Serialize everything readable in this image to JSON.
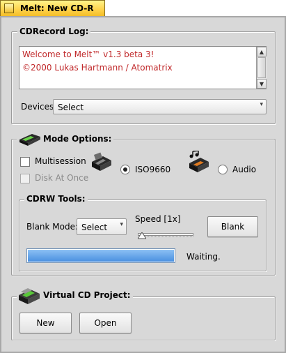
{
  "window": {
    "title": "Melt: New CD-R",
    "accent": "#ffd24a"
  },
  "log": {
    "label": "CDRecord Log:",
    "lines": [
      "Welcome to Melt™ v1.3 beta 3!",
      "©2000 Lukas Hartmann / Atomatrix"
    ],
    "text_color": "#c0282a"
  },
  "devices": {
    "label": "Devices:",
    "selected": "Select"
  },
  "mode": {
    "label": "Mode Options:",
    "multisession_label": "Multisession",
    "multisession_checked": false,
    "disk_at_once_label": "Disk At Once",
    "disk_at_once_enabled": false,
    "iso_label": "ISO9660",
    "audio_label": "Audio",
    "selected": "ISO9660",
    "icons": [
      "cd-drive-icon",
      "audio-cd-drive-icon",
      "cd-recorder-icon"
    ]
  },
  "cdrw": {
    "label": "CDRW Tools:",
    "blank_mode_label": "Blank Mode:",
    "blank_mode_selected": "Select",
    "speed_label": "Speed [1x]",
    "speed_value": 1,
    "blank_button": "Blank",
    "progress": 1.0,
    "progress_color": "#5aa0e8",
    "status": "Waiting."
  },
  "project": {
    "label": "Virtual CD Project:",
    "new_button": "New",
    "open_button": "Open",
    "icon": "virtual-cd-drive-icon"
  }
}
